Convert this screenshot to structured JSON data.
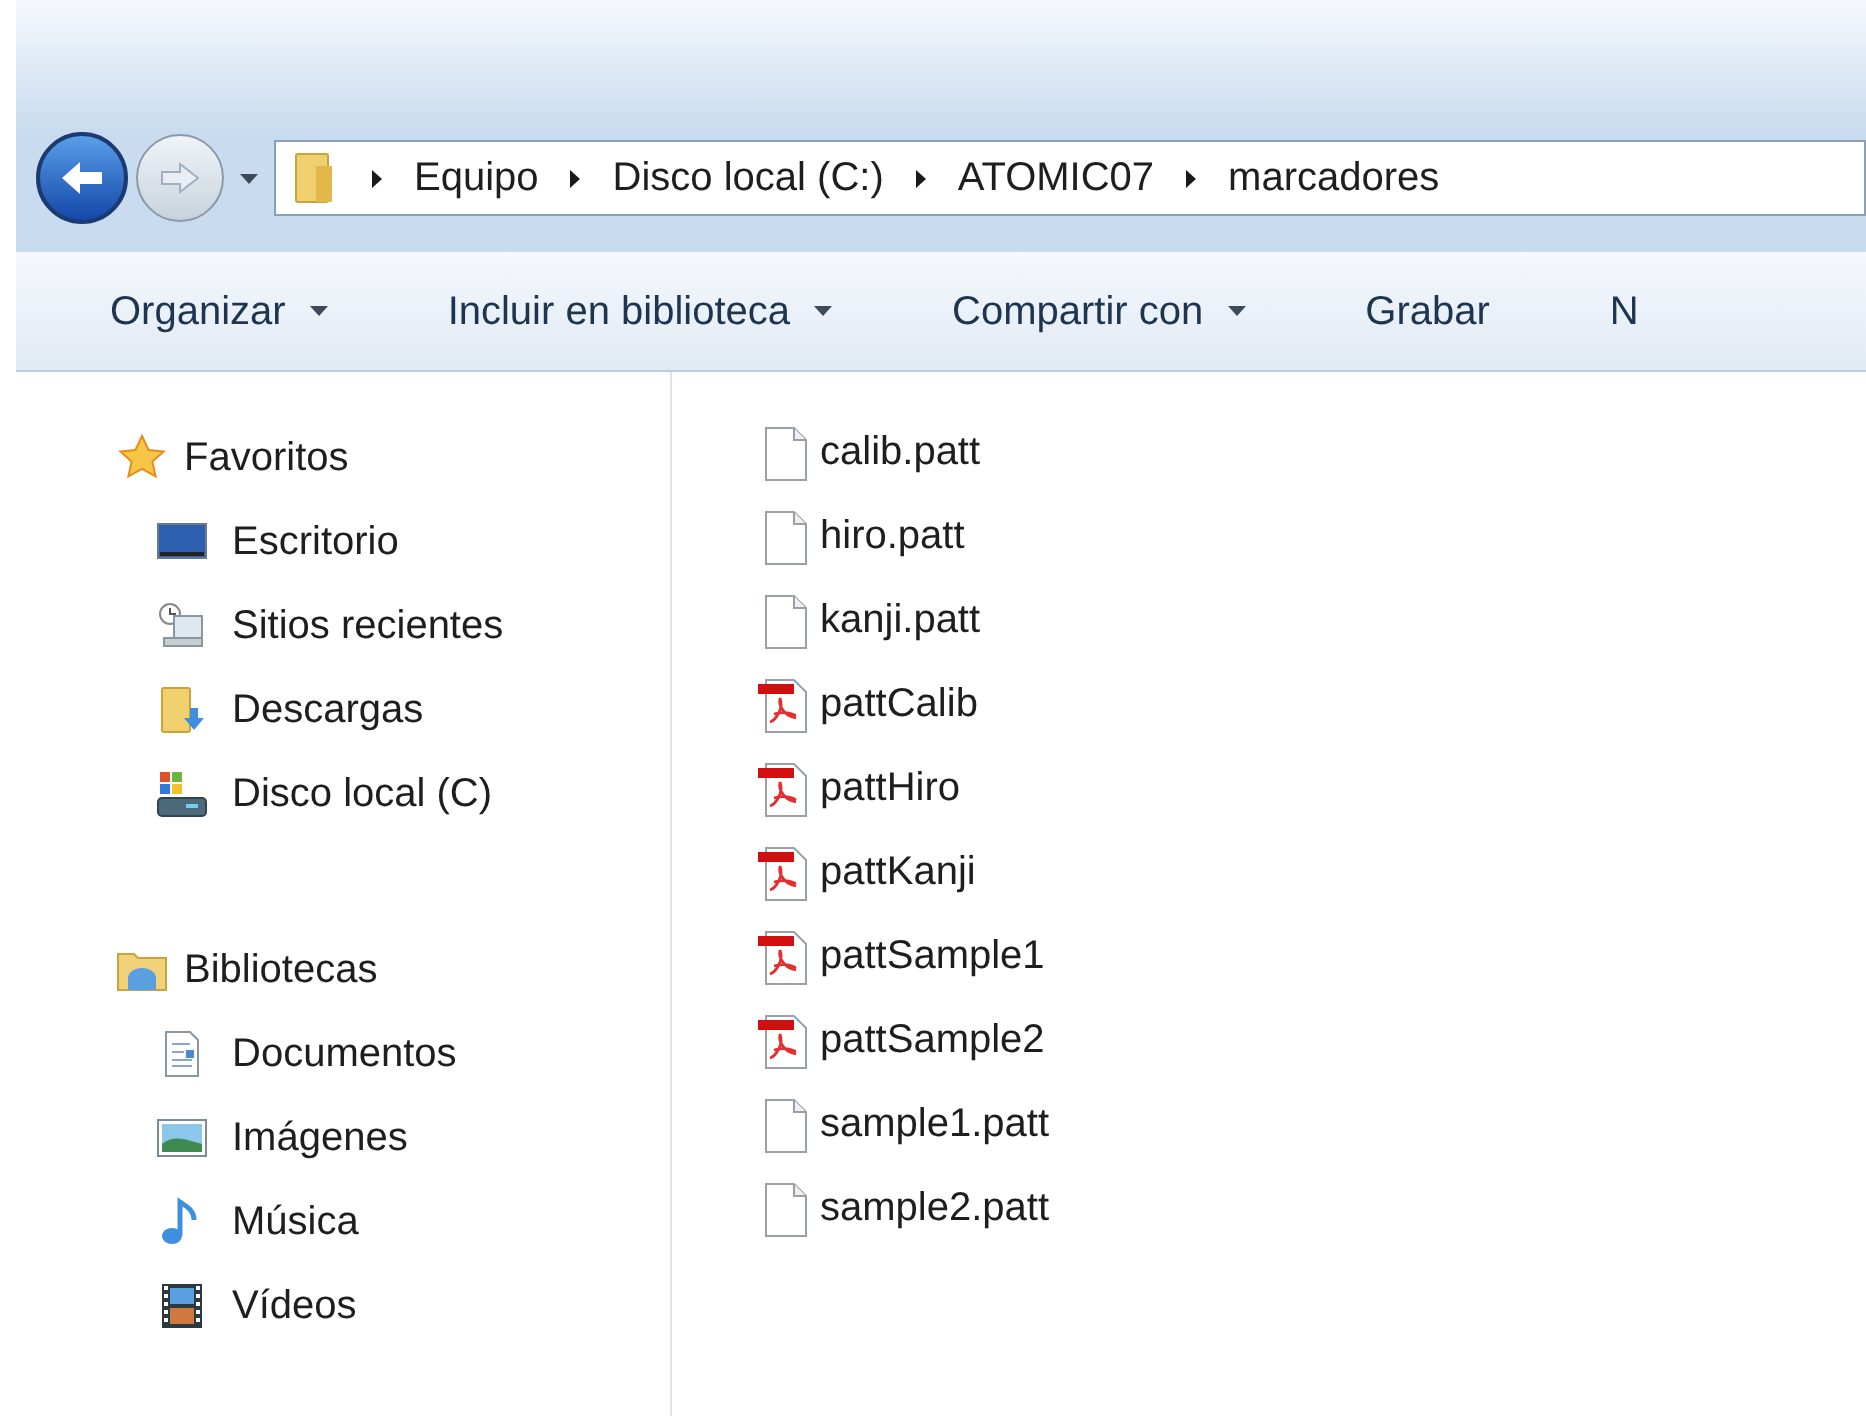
{
  "address_bar": {
    "crumbs": [
      "Equipo",
      "Disco local (C:)",
      "ATOMIC07",
      "marcadores"
    ]
  },
  "toolbar": [
    {
      "label": "Organizar",
      "dropdown": true
    },
    {
      "label": "Incluir en biblioteca",
      "dropdown": true
    },
    {
      "label": "Compartir con",
      "dropdown": true
    },
    {
      "label": "Grabar",
      "dropdown": false
    },
    {
      "label": "N",
      "dropdown": false
    }
  ],
  "sidebar": {
    "sections": [
      {
        "label": "Favoritos",
        "kind": "star",
        "children": [
          {
            "label": "Escritorio",
            "kind": "desktop"
          },
          {
            "label": "Sitios recientes",
            "kind": "recent"
          },
          {
            "label": "Descargas",
            "kind": "downloads"
          },
          {
            "label": "Disco local (C)",
            "kind": "drive"
          }
        ]
      },
      {
        "label": "Bibliotecas",
        "kind": "libraries",
        "children": [
          {
            "label": "Documentos",
            "kind": "documents"
          },
          {
            "label": "Imágenes",
            "kind": "pictures"
          },
          {
            "label": "Música",
            "kind": "music"
          },
          {
            "label": "Vídeos",
            "kind": "videos"
          }
        ]
      }
    ]
  },
  "files": [
    {
      "name": "calib.patt",
      "kind": "blank"
    },
    {
      "name": "hiro.patt",
      "kind": "blank"
    },
    {
      "name": "kanji.patt",
      "kind": "blank"
    },
    {
      "name": "pattCalib",
      "kind": "pdf"
    },
    {
      "name": "pattHiro",
      "kind": "pdf"
    },
    {
      "name": "pattKanji",
      "kind": "pdf"
    },
    {
      "name": "pattSample1",
      "kind": "pdf"
    },
    {
      "name": "pattSample2",
      "kind": "pdf"
    },
    {
      "name": "sample1.patt",
      "kind": "blank"
    },
    {
      "name": "sample2.patt",
      "kind": "blank"
    }
  ]
}
